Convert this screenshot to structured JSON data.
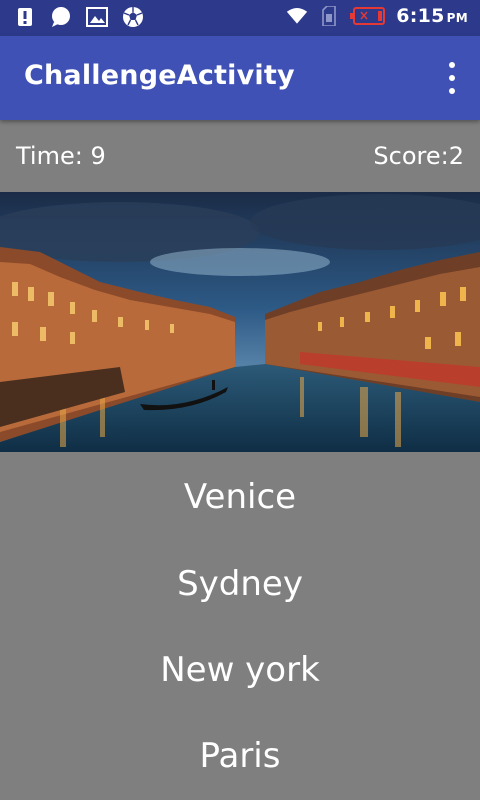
{
  "status_bar": {
    "time": "6:15",
    "ampm": "PM",
    "icons_left": [
      "alert-icon",
      "chat-bubble-icon",
      "image-icon",
      "soccer-ball-icon"
    ],
    "icons_right": [
      "wifi-icon",
      "sim-icon",
      "battery-icon"
    ],
    "battery_color": "#e53935"
  },
  "app_bar": {
    "title": "ChallengeActivity",
    "overflow_icon": "more-vert-icon",
    "color": "#3f51b5"
  },
  "game": {
    "time_label": "Time: 9",
    "score_label": "Score:2",
    "image_icon": "venice-canal-photo"
  },
  "answers": [
    {
      "label": "Venice"
    },
    {
      "label": "Sydney"
    },
    {
      "label": "New york"
    },
    {
      "label": "Paris"
    }
  ],
  "colors": {
    "background": "#7f7f7f",
    "status_bar": "#2d3a8c",
    "text": "#ffffff"
  }
}
